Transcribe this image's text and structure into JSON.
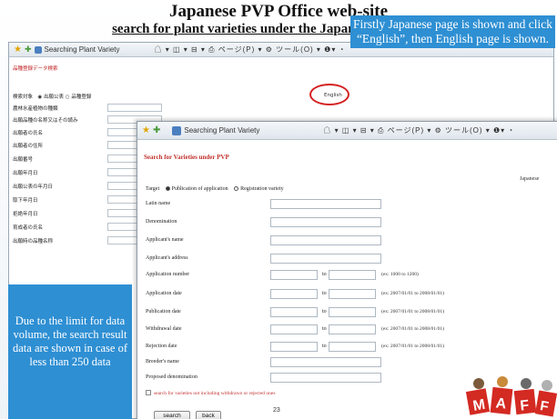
{
  "slide": {
    "title": "Japanese PVP Office web-site",
    "subtitle": "search for plant varieties under the Japanese PVP system",
    "page_number": "23",
    "note_top": "Firstly Japanese page is shown and click “English”, then English page is shown.",
    "note_bottom": "Due to the limit for data volume, the search result data are shown in case of less than 250 data"
  },
  "back_window": {
    "tab": "Searching Plant Variety",
    "toolbar": "☖ ▾ ◫ ▾ ⊟ ▾ ⎙ ページ(P) ▾ ⚙ ツール(O) ▾ ❶▾ ◔",
    "heading": "品種登録データ検索",
    "english_link": "English",
    "rows": [
      "検索対象　◉ 出願公表 ○ 品種登録",
      "農林水産植物の種類",
      "出願品種の名称又はその読み",
      "出願者の氏名",
      "出願者の住所",
      "出願番号",
      "出願年月日",
      "出願公表の年月日",
      "取下年月日",
      "拒絶年月日",
      "育成者の氏名",
      "出願時の品種名称"
    ]
  },
  "front_window": {
    "tab": "Searching Plant Variety",
    "toolbar": "☖ ▾ ◫ ▾ ⊟ ▾ ⎙ ページ(P) ▾ ⚙ ツール(O) ▾ ❶▾ ◔",
    "heading": "Search for Varieties under PVP",
    "language": "Japanese",
    "target_label": "Target",
    "target_opt1": "Publication of application",
    "target_opt2": "Registration variety",
    "labels": [
      "Latin name",
      "Denomination",
      "Applicant's name",
      "Applicant's address",
      "Application number",
      "Application date",
      "Publication date",
      "Withdrawal date",
      "Rejection date",
      "Breeder's name",
      "Proposed denomination"
    ],
    "to": "to",
    "examples": {
      "number": "(ex: 1000 to 1200)",
      "date": "(ex: 2007/01/01 to 2008/01/01)"
    },
    "checkbox": "search for varieties not including withdrawn or rejected ones",
    "search_button": "search",
    "back_button": "back"
  }
}
